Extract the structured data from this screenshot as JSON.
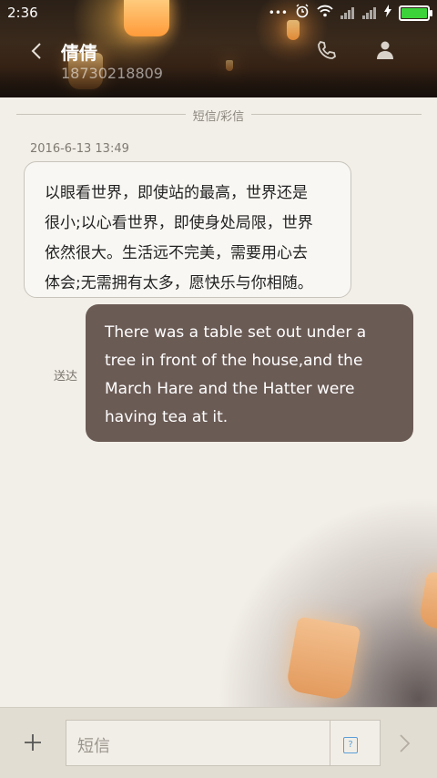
{
  "status_bar": {
    "time": "2:36",
    "dots": "•••",
    "battery_color": "#3bd23a"
  },
  "header": {
    "contact_name": "倩倩",
    "contact_number": "18730218809",
    "back_icon": "chevron-left-icon",
    "call_icon": "phone-icon",
    "contact_icon": "person-icon"
  },
  "conversation": {
    "divider_label": "短信/彩信",
    "timestamp": "2016-6-13 13:49",
    "incoming": {
      "lines": [
        "以眼看世界，即使站的最高，世界还是",
        "很小;以心看世界，即使身处局限，世界",
        "依然很大。生活远不完美，需要用心去",
        "体会;无需拥有太多，愿快乐与你相随。"
      ]
    },
    "outgoing": {
      "status": "送达",
      "lines": [
        "There was a table set out under a",
        "tree in front of the house,and the",
        "March Hare and the Hatter were",
        "having tea at it."
      ],
      "bubble_color": "#6b5b55"
    }
  },
  "input_bar": {
    "placeholder": "短信",
    "add_icon": "plus-icon",
    "sim_label": "?",
    "send_icon": "chevron-right-icon"
  }
}
